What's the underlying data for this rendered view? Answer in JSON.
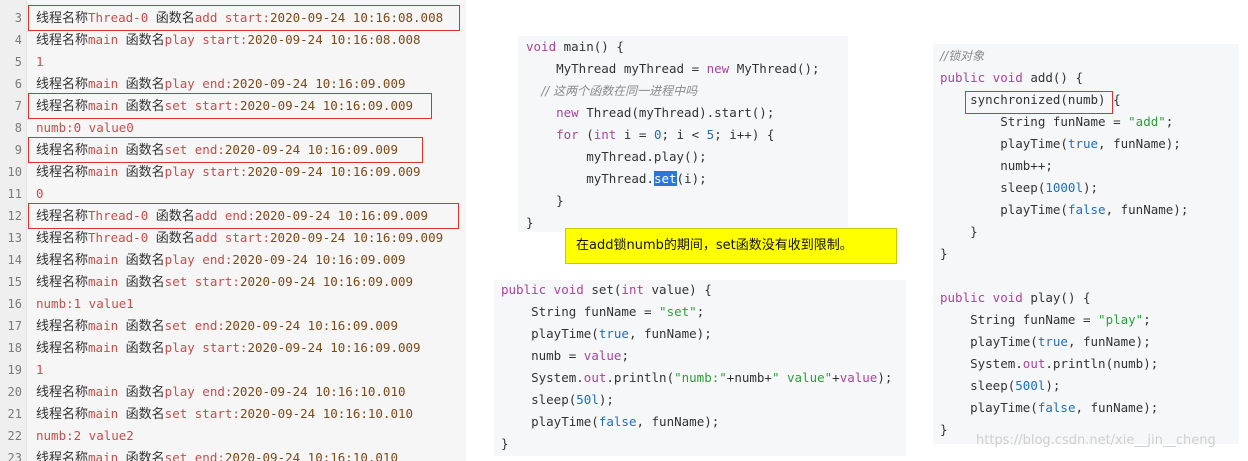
{
  "log": {
    "lines": [
      {
        "n": "3",
        "segs": [
          [
            "cjk",
            "线程名称"
          ],
          [
            "red",
            "Thread-0 "
          ],
          [
            "cjk",
            "函数名"
          ],
          [
            "red",
            "add start:"
          ],
          [
            "ts",
            "2020-09-24 10:16:08.008"
          ]
        ]
      },
      {
        "n": "4",
        "segs": [
          [
            "cjk",
            "线程名称"
          ],
          [
            "red",
            "main "
          ],
          [
            "cjk",
            "函数名"
          ],
          [
            "red",
            "play start:"
          ],
          [
            "ts",
            "2020-09-24 10:16:08.008"
          ]
        ]
      },
      {
        "n": "5",
        "segs": [
          [
            "red",
            "1"
          ]
        ]
      },
      {
        "n": "6",
        "segs": [
          [
            "cjk",
            "线程名称"
          ],
          [
            "red",
            "main "
          ],
          [
            "cjk",
            "函数名"
          ],
          [
            "red",
            "play end:"
          ],
          [
            "ts",
            "2020-09-24 10:16:09.009"
          ]
        ]
      },
      {
        "n": "7",
        "segs": [
          [
            "cjk",
            "线程名称"
          ],
          [
            "red",
            "main "
          ],
          [
            "cjk",
            "函数名"
          ],
          [
            "red",
            "set start:"
          ],
          [
            "ts",
            "2020-09-24 10:16:09.009"
          ]
        ]
      },
      {
        "n": "8",
        "segs": [
          [
            "red",
            "numb:0 value0"
          ]
        ]
      },
      {
        "n": "9",
        "segs": [
          [
            "cjk",
            "线程名称"
          ],
          [
            "red",
            "main "
          ],
          [
            "cjk",
            "函数名"
          ],
          [
            "red",
            "set end:"
          ],
          [
            "ts",
            "2020-09-24 10:16:09.009"
          ]
        ]
      },
      {
        "n": "10",
        "segs": [
          [
            "cjk",
            "线程名称"
          ],
          [
            "red",
            "main "
          ],
          [
            "cjk",
            "函数名"
          ],
          [
            "red",
            "play start:"
          ],
          [
            "ts",
            "2020-09-24 10:16:09.009"
          ]
        ]
      },
      {
        "n": "11",
        "segs": [
          [
            "red",
            "0"
          ]
        ]
      },
      {
        "n": "12",
        "segs": [
          [
            "cjk",
            "线程名称"
          ],
          [
            "red",
            "Thread-0 "
          ],
          [
            "cjk",
            "函数名"
          ],
          [
            "red",
            "add end:"
          ],
          [
            "ts",
            "2020-09-24 10:16:09.009"
          ]
        ]
      },
      {
        "n": "13",
        "segs": [
          [
            "cjk",
            "线程名称"
          ],
          [
            "red",
            "Thread-0 "
          ],
          [
            "cjk",
            "函数名"
          ],
          [
            "red",
            "add start:"
          ],
          [
            "ts",
            "2020-09-24 10:16:09.009"
          ]
        ]
      },
      {
        "n": "14",
        "segs": [
          [
            "cjk",
            "线程名称"
          ],
          [
            "red",
            "main "
          ],
          [
            "cjk",
            "函数名"
          ],
          [
            "red",
            "play end:"
          ],
          [
            "ts",
            "2020-09-24 10:16:09.009"
          ]
        ]
      },
      {
        "n": "15",
        "segs": [
          [
            "cjk",
            "线程名称"
          ],
          [
            "red",
            "main "
          ],
          [
            "cjk",
            "函数名"
          ],
          [
            "red",
            "set start:"
          ],
          [
            "ts",
            "2020-09-24 10:16:09.009"
          ]
        ]
      },
      {
        "n": "16",
        "segs": [
          [
            "red",
            "numb:1 value1"
          ]
        ]
      },
      {
        "n": "17",
        "segs": [
          [
            "cjk",
            "线程名称"
          ],
          [
            "red",
            "main "
          ],
          [
            "cjk",
            "函数名"
          ],
          [
            "red",
            "set end:"
          ],
          [
            "ts",
            "2020-09-24 10:16:09.009"
          ]
        ]
      },
      {
        "n": "18",
        "segs": [
          [
            "cjk",
            "线程名称"
          ],
          [
            "red",
            "main "
          ],
          [
            "cjk",
            "函数名"
          ],
          [
            "red",
            "play start:"
          ],
          [
            "ts",
            "2020-09-24 10:16:09.009"
          ]
        ]
      },
      {
        "n": "19",
        "segs": [
          [
            "red",
            "1"
          ]
        ]
      },
      {
        "n": "20",
        "segs": [
          [
            "cjk",
            "线程名称"
          ],
          [
            "red",
            "main "
          ],
          [
            "cjk",
            "函数名"
          ],
          [
            "red",
            "play end:"
          ],
          [
            "ts",
            "2020-09-24 10:16:10.010"
          ]
        ]
      },
      {
        "n": "21",
        "segs": [
          [
            "cjk",
            "线程名称"
          ],
          [
            "red",
            "main "
          ],
          [
            "cjk",
            "函数名"
          ],
          [
            "red",
            "set start:"
          ],
          [
            "ts",
            "2020-09-24 10:16:10.010"
          ]
        ]
      },
      {
        "n": "22",
        "segs": [
          [
            "red",
            "numb:2 value2"
          ]
        ]
      },
      {
        "n": "23",
        "segs": [
          [
            "cjk",
            "线程名称"
          ],
          [
            "red",
            "main "
          ],
          [
            "cjk",
            "函数名"
          ],
          [
            "red",
            "set end:"
          ],
          [
            "ts",
            "2020-09-24 10:16:10.010"
          ]
        ]
      }
    ]
  },
  "main_code": {
    "lines": [
      [
        [
          "kw",
          "void "
        ],
        [
          "plain",
          "main() {"
        ]
      ],
      [
        [
          "plain",
          "    MyThread myThread = "
        ],
        [
          "kw",
          "new "
        ],
        [
          "plain",
          "MyThread();"
        ]
      ],
      [
        [
          "cmt",
          "    // 这两个函数在同一进程中吗"
        ]
      ],
      [
        [
          "plain",
          "    "
        ],
        [
          "kw",
          "new "
        ],
        [
          "plain",
          "Thread(myThread).start();"
        ]
      ],
      [
        [
          "plain",
          "    "
        ],
        [
          "kw",
          "for "
        ],
        [
          "plain",
          "("
        ],
        [
          "kw",
          "int "
        ],
        [
          "plain",
          "i = "
        ],
        [
          "num",
          "0"
        ],
        [
          "plain",
          "; i < "
        ],
        [
          "num",
          "5"
        ],
        [
          "plain",
          "; i++) {"
        ]
      ],
      [
        [
          "plain",
          "        myThread.play();"
        ]
      ],
      [
        [
          "plain",
          "        myThread."
        ],
        [
          "sel",
          "set"
        ],
        [
          "plain",
          "(i);"
        ]
      ],
      [
        [
          "plain",
          "    }"
        ]
      ],
      [
        [
          "plain",
          "}"
        ]
      ]
    ]
  },
  "set_code": {
    "lines": [
      [
        [
          "kw",
          "public void "
        ],
        [
          "plain",
          "set("
        ],
        [
          "kw",
          "int "
        ],
        [
          "plain",
          "value) {"
        ]
      ],
      [
        [
          "plain",
          "    String funName = "
        ],
        [
          "str",
          "\"set\""
        ],
        [
          "plain",
          ";"
        ]
      ],
      [
        [
          "plain",
          "    playTime("
        ],
        [
          "lit",
          "true"
        ],
        [
          "plain",
          ", funName);"
        ]
      ],
      [
        [
          "plain",
          "    numb = "
        ],
        [
          "kw",
          "value"
        ],
        [
          "plain",
          ";"
        ]
      ],
      [
        [
          "plain",
          "    System."
        ],
        [
          "kw",
          "out"
        ],
        [
          "plain",
          ".println("
        ],
        [
          "str",
          "\"numb:\""
        ],
        [
          "plain",
          "+numb+"
        ],
        [
          "str",
          "\" value\""
        ],
        [
          "plain",
          "+"
        ],
        [
          "kw",
          "value"
        ],
        [
          "plain",
          ");"
        ]
      ],
      [
        [
          "plain",
          "    sleep("
        ],
        [
          "num",
          "50l"
        ],
        [
          "plain",
          ");"
        ]
      ],
      [
        [
          "plain",
          "    playTime("
        ],
        [
          "lit",
          "false"
        ],
        [
          "plain",
          ", funName);"
        ]
      ],
      [
        [
          "plain",
          "}"
        ]
      ]
    ]
  },
  "lock_code": {
    "lines": [
      [
        [
          "cmt",
          "//锁对象"
        ]
      ],
      [
        [
          "kw",
          "public void "
        ],
        [
          "plain",
          "add() {"
        ]
      ],
      [
        [
          "plain",
          "    synchronized(numb) {"
        ]
      ],
      [
        [
          "plain",
          "        String funName = "
        ],
        [
          "str",
          "\"add\""
        ],
        [
          "plain",
          ";"
        ]
      ],
      [
        [
          "plain",
          "        playTime("
        ],
        [
          "lit",
          "true"
        ],
        [
          "plain",
          ", funName);"
        ]
      ],
      [
        [
          "plain",
          "        numb++;"
        ]
      ],
      [
        [
          "plain",
          "        sleep("
        ],
        [
          "num",
          "1000l"
        ],
        [
          "plain",
          ");"
        ]
      ],
      [
        [
          "plain",
          "        playTime("
        ],
        [
          "lit",
          "false"
        ],
        [
          "plain",
          ", funName);"
        ]
      ],
      [
        [
          "plain",
          "    }"
        ]
      ],
      [
        [
          "plain",
          "}"
        ]
      ],
      [
        [
          "plain",
          ""
        ]
      ],
      [
        [
          "kw",
          "public void "
        ],
        [
          "plain",
          "play() {"
        ]
      ],
      [
        [
          "plain",
          "    String funName = "
        ],
        [
          "str",
          "\"play\""
        ],
        [
          "plain",
          ";"
        ]
      ],
      [
        [
          "plain",
          "    playTime("
        ],
        [
          "lit",
          "true"
        ],
        [
          "plain",
          ", funName);"
        ]
      ],
      [
        [
          "plain",
          "    System."
        ],
        [
          "kw",
          "out"
        ],
        [
          "plain",
          ".println(numb);"
        ]
      ],
      [
        [
          "plain",
          "    sleep("
        ],
        [
          "num",
          "500l"
        ],
        [
          "plain",
          ");"
        ]
      ],
      [
        [
          "plain",
          "    playTime("
        ],
        [
          "lit",
          "false"
        ],
        [
          "plain",
          ", funName);"
        ]
      ],
      [
        [
          "plain",
          "}"
        ]
      ]
    ]
  },
  "note": {
    "text": "在add锁numb的期间，set函数没有收到限制。"
  },
  "watermark": {
    "text": "https://blog.csdn.net/xie__jin__cheng"
  },
  "colors": {
    "highlight_border": "#d9342b",
    "note_bg": "#ffff00",
    "keyword": "#a6469a",
    "string": "#2f9c3c",
    "number": "#1e6fb8",
    "selection": "#2b77d9"
  }
}
